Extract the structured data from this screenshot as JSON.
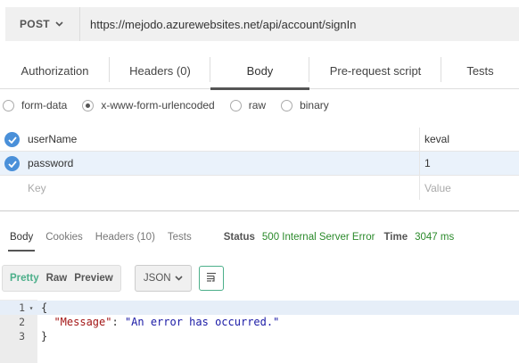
{
  "request": {
    "method": "POST",
    "url": "https://mejodo.azurewebsites.net/api/account/signIn"
  },
  "request_tabs": [
    {
      "label": "Authorization",
      "active": false
    },
    {
      "label": "Headers (0)",
      "active": false
    },
    {
      "label": "Body",
      "active": true
    },
    {
      "label": "Pre-request script",
      "active": false
    },
    {
      "label": "Tests",
      "active": false
    }
  ],
  "body_types": [
    {
      "label": "form-data",
      "selected": false
    },
    {
      "label": "x-www-form-urlencoded",
      "selected": true
    },
    {
      "label": "raw",
      "selected": false
    },
    {
      "label": "binary",
      "selected": false
    }
  ],
  "params": [
    {
      "key": "userName",
      "value": "keval",
      "enabled": true
    },
    {
      "key": "password",
      "value": "1",
      "enabled": true
    }
  ],
  "new_param": {
    "key_placeholder": "Key",
    "value_placeholder": "Value"
  },
  "response_tabs": [
    {
      "label": "Body",
      "active": true
    },
    {
      "label": "Cookies",
      "active": false
    },
    {
      "label": "Headers (10)",
      "active": false
    },
    {
      "label": "Tests",
      "active": false
    }
  ],
  "status": {
    "label": "Status",
    "value": "500 Internal Server Error",
    "time_label": "Time",
    "time_value": "3047 ms",
    "color": "#2b8a2b"
  },
  "view_modes": [
    {
      "label": "Pretty",
      "active": true
    },
    {
      "label": "Raw",
      "active": false
    },
    {
      "label": "Preview",
      "active": false
    }
  ],
  "format": {
    "selected": "JSON",
    "icon": "chevron-down-icon"
  },
  "wrap_icon": "wrap-lines-icon",
  "code": {
    "line_numbers": [
      "1",
      "2",
      "3"
    ],
    "open_brace": "{",
    "key": "\"Message\"",
    "colon": ": ",
    "value": "\"An error has occurred.\"",
    "close_brace": "}"
  }
}
